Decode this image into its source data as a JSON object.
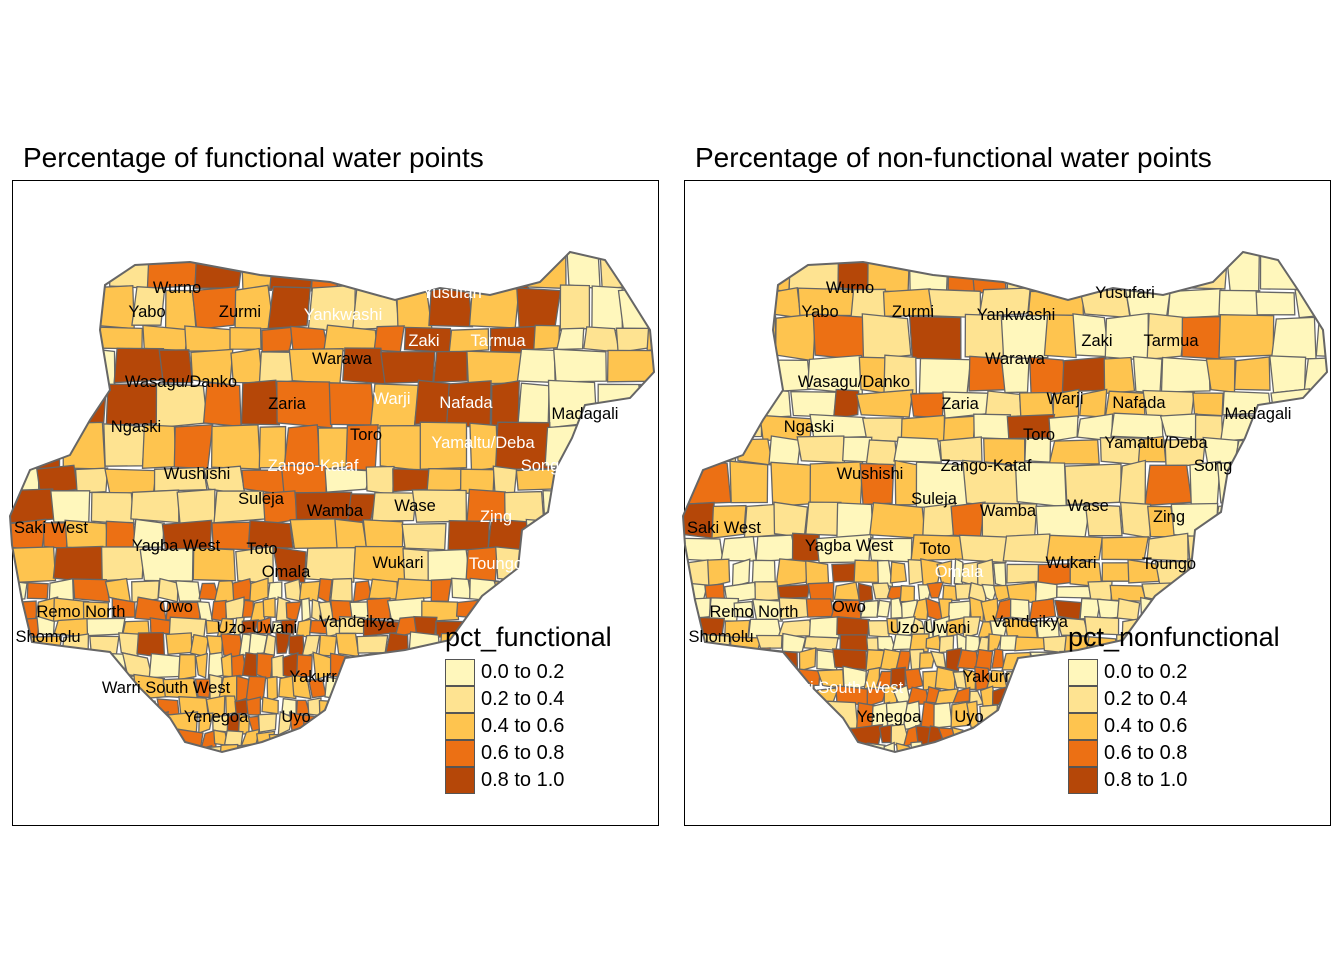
{
  "panels": [
    {
      "title": "Percentage of functional water points",
      "legend_title": "pct_functional",
      "labels": [
        {
          "text": "Wurno",
          "color": "#000"
        },
        {
          "text": "Yabo",
          "color": "#000"
        },
        {
          "text": "Zurmi",
          "color": "#000"
        },
        {
          "text": "Yankwashi",
          "color": "#fff"
        },
        {
          "text": "Yusufari",
          "color": "#fff"
        },
        {
          "text": "Zaki",
          "color": "#fff"
        },
        {
          "text": "Tarmua",
          "color": "#fff"
        },
        {
          "text": "Warawa",
          "color": "#000"
        },
        {
          "text": "Wasagu/Danko",
          "color": "#000"
        },
        {
          "text": "Warji",
          "color": "#fff"
        },
        {
          "text": "Nafada",
          "color": "#fff"
        },
        {
          "text": "Madagali",
          "color": "#000"
        },
        {
          "text": "Zaria",
          "color": "#000"
        },
        {
          "text": "Ngaski",
          "color": "#000"
        },
        {
          "text": "Toro",
          "color": "#000"
        },
        {
          "text": "Yamaltu/Deba",
          "color": "#fff"
        },
        {
          "text": "Wushishi",
          "color": "#000"
        },
        {
          "text": "Zango-Kataf",
          "color": "#fff"
        },
        {
          "text": "Song",
          "color": "#fff"
        },
        {
          "text": "Suleja",
          "color": "#000"
        },
        {
          "text": "Wamba",
          "color": "#000"
        },
        {
          "text": "Wase",
          "color": "#000"
        },
        {
          "text": "Saki West",
          "color": "#000"
        },
        {
          "text": "Zing",
          "color": "#fff"
        },
        {
          "text": "Yagba West",
          "color": "#000"
        },
        {
          "text": "Toto",
          "color": "#000"
        },
        {
          "text": "Wukari",
          "color": "#000"
        },
        {
          "text": "Toungo",
          "color": "#fff"
        },
        {
          "text": "Omala",
          "color": "#000"
        },
        {
          "text": "Remo North",
          "color": "#000"
        },
        {
          "text": "Owo",
          "color": "#000"
        },
        {
          "text": "Shomolu",
          "color": "#000"
        },
        {
          "text": "Uzo-Uwani",
          "color": "#000"
        },
        {
          "text": "Vandeikya",
          "color": "#000"
        },
        {
          "text": "Yakurr",
          "color": "#000"
        },
        {
          "text": "Warri South West",
          "color": "#000"
        },
        {
          "text": "Yenegoa",
          "color": "#000"
        },
        {
          "text": "Uyo",
          "color": "#000"
        }
      ]
    },
    {
      "title": "Percentage of non-functional water points",
      "legend_title": "pct_nonfunctional",
      "labels": [
        {
          "text": "Wurno",
          "color": "#000"
        },
        {
          "text": "Yabo",
          "color": "#000"
        },
        {
          "text": "Zurmi",
          "color": "#000"
        },
        {
          "text": "Yankwashi",
          "color": "#000"
        },
        {
          "text": "Yusufari",
          "color": "#000"
        },
        {
          "text": "Zaki",
          "color": "#000"
        },
        {
          "text": "Tarmua",
          "color": "#000"
        },
        {
          "text": "Warawa",
          "color": "#000"
        },
        {
          "text": "Wasagu/Danko",
          "color": "#000"
        },
        {
          "text": "Warji",
          "color": "#000"
        },
        {
          "text": "Nafada",
          "color": "#000"
        },
        {
          "text": "Madagali",
          "color": "#000"
        },
        {
          "text": "Zaria",
          "color": "#000"
        },
        {
          "text": "Ngaski",
          "color": "#000"
        },
        {
          "text": "Toro",
          "color": "#000"
        },
        {
          "text": "Yamaltu/Deba",
          "color": "#000"
        },
        {
          "text": "Wushishi",
          "color": "#000"
        },
        {
          "text": "Zango-Kataf",
          "color": "#000"
        },
        {
          "text": "Song",
          "color": "#000"
        },
        {
          "text": "Suleja",
          "color": "#000"
        },
        {
          "text": "Wamba",
          "color": "#000"
        },
        {
          "text": "Wase",
          "color": "#000"
        },
        {
          "text": "Saki West",
          "color": "#000"
        },
        {
          "text": "Zing",
          "color": "#000"
        },
        {
          "text": "Yagba West",
          "color": "#000"
        },
        {
          "text": "Toto",
          "color": "#000"
        },
        {
          "text": "Wukari",
          "color": "#000"
        },
        {
          "text": "Toungo",
          "color": "#000"
        },
        {
          "text": "Omala",
          "color": "#fff"
        },
        {
          "text": "Remo North",
          "color": "#000"
        },
        {
          "text": "Owo",
          "color": "#000"
        },
        {
          "text": "Shomolu",
          "color": "#000"
        },
        {
          "text": "Uzo-Uwani",
          "color": "#000"
        },
        {
          "text": "Vandeikya",
          "color": "#000"
        },
        {
          "text": "Yakurr",
          "color": "#000"
        },
        {
          "text": "Warri South West",
          "color": "#fff"
        },
        {
          "text": "Yenegoa",
          "color": "#000"
        },
        {
          "text": "Uyo",
          "color": "#000"
        }
      ]
    }
  ],
  "legend_classes": [
    {
      "label": "0.0 to 0.2",
      "color": "#FFF7BC"
    },
    {
      "label": "0.2 to 0.4",
      "color": "#FEE391"
    },
    {
      "label": "0.4 to 0.6",
      "color": "#FEC44F"
    },
    {
      "label": "0.6 to 0.8",
      "color": "#EC7014"
    },
    {
      "label": "0.8 to 1.0",
      "color": "#B54708"
    }
  ],
  "region_border_color": "#666666"
}
